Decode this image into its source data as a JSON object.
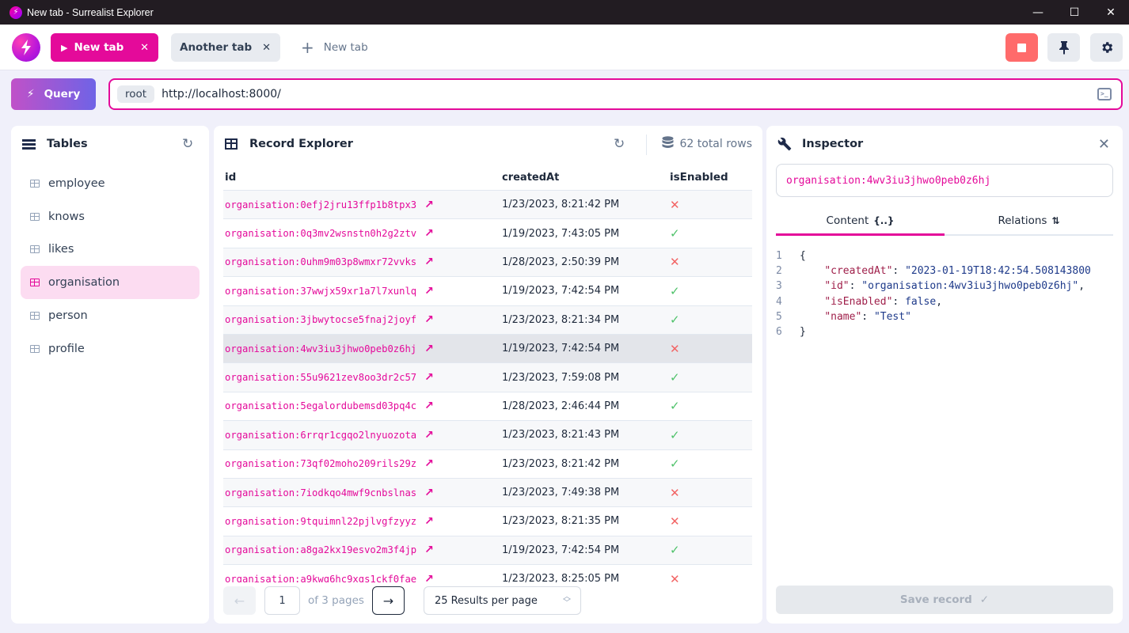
{
  "window": {
    "title": "New tab - Surrealist Explorer",
    "controls": {
      "minimize": "—",
      "maximize": "☐",
      "close": "✕"
    }
  },
  "tabs": [
    {
      "label": "New tab",
      "active": true,
      "close": "✕"
    },
    {
      "label": "Another tab",
      "active": false,
      "close": "✕"
    }
  ],
  "new_tab": {
    "label": "New tab",
    "icon": "+"
  },
  "toolbar": {
    "stop_label": "",
    "pin_icon": "📌",
    "settings_icon": "⚙"
  },
  "query_button": {
    "label": "Query",
    "icon": "⚡"
  },
  "connection": {
    "user": "root",
    "url": "http://localhost:8000/",
    "console_icon": ">_"
  },
  "tables_panel": {
    "title": "Tables",
    "items": [
      {
        "label": "employee",
        "active": false
      },
      {
        "label": "knows",
        "active": false
      },
      {
        "label": "likes",
        "active": false
      },
      {
        "label": "organisation",
        "active": true
      },
      {
        "label": "person",
        "active": false
      },
      {
        "label": "profile",
        "active": false
      }
    ]
  },
  "records_panel": {
    "title": "Record Explorer",
    "total_rows": "62 total rows",
    "columns": [
      "id",
      "createdAt",
      "isEnabled"
    ],
    "rows": [
      {
        "id": "organisation:0efj2jru13ffp1b8tpx3",
        "createdAt": "1/23/2023, 8:21:42 PM",
        "isEnabled": false
      },
      {
        "id": "organisation:0q3mv2wsnstn0h2g2ztv",
        "createdAt": "1/19/2023, 7:43:05 PM",
        "isEnabled": true
      },
      {
        "id": "organisation:0uhm9m03p8wmxr72vvks",
        "createdAt": "1/28/2023, 2:50:39 PM",
        "isEnabled": false
      },
      {
        "id": "organisation:37wwjx59xr1a7l7xunlq",
        "createdAt": "1/19/2023, 7:42:54 PM",
        "isEnabled": true
      },
      {
        "id": "organisation:3jbwytocse5fnaj2joyf",
        "createdAt": "1/23/2023, 8:21:34 PM",
        "isEnabled": true
      },
      {
        "id": "organisation:4wv3iu3jhwo0peb0z6hj",
        "createdAt": "1/19/2023, 7:42:54 PM",
        "isEnabled": false,
        "selected": true
      },
      {
        "id": "organisation:55u9621zev8oo3dr2c57",
        "createdAt": "1/23/2023, 7:59:08 PM",
        "isEnabled": true
      },
      {
        "id": "organisation:5egalordubemsd03pq4c",
        "createdAt": "1/28/2023, 2:46:44 PM",
        "isEnabled": true
      },
      {
        "id": "organisation:6rrqr1cgqo2lnyuozota",
        "createdAt": "1/23/2023, 8:21:43 PM",
        "isEnabled": true
      },
      {
        "id": "organisation:73qf02moho209rils29z",
        "createdAt": "1/23/2023, 8:21:42 PM",
        "isEnabled": true
      },
      {
        "id": "organisation:7iodkqo4mwf9cnbslnas",
        "createdAt": "1/23/2023, 7:49:38 PM",
        "isEnabled": false
      },
      {
        "id": "organisation:9tquimnl22pjlvgfzyyz",
        "createdAt": "1/23/2023, 8:21:35 PM",
        "isEnabled": false
      },
      {
        "id": "organisation:a8ga2kx19esvo2m3f4jp",
        "createdAt": "1/19/2023, 7:42:54 PM",
        "isEnabled": true
      },
      {
        "id": "organisation:a9kwg6hc9xgs1ckf0fae",
        "createdAt": "1/23/2023, 8:25:05 PM",
        "isEnabled": false
      }
    ],
    "pagination": {
      "current_page": "1",
      "of_label": "of 3 pages",
      "prev_icon": "←",
      "next_icon": "→",
      "per_page": "25 Results per page"
    }
  },
  "inspector": {
    "title": "Inspector",
    "record_id": "organisation:4wv3iu3jhwo0peb0z6hj",
    "tabs": [
      {
        "label": "Content",
        "icon": "{..}",
        "active": true
      },
      {
        "label": "Relations",
        "icon": "⇅",
        "active": false
      }
    ],
    "code_lines": [
      {
        "n": "1",
        "parts": [
          [
            "p",
            "{"
          ]
        ]
      },
      {
        "n": "2",
        "parts": [
          [
            "p",
            "    "
          ],
          [
            "k",
            "\"createdAt\""
          ],
          [
            "p",
            ": "
          ],
          [
            "s",
            "\"2023-01-19T18:42:54.508143800"
          ]
        ]
      },
      {
        "n": "3",
        "parts": [
          [
            "p",
            "    "
          ],
          [
            "k",
            "\"id\""
          ],
          [
            "p",
            ": "
          ],
          [
            "s",
            "\"organisation:4wv3iu3jhwo0peb0z6hj\""
          ],
          [
            "p",
            ","
          ]
        ]
      },
      {
        "n": "4",
        "parts": [
          [
            "p",
            "    "
          ],
          [
            "k",
            "\"isEnabled\""
          ],
          [
            "p",
            ": "
          ],
          [
            "b",
            "false"
          ],
          [
            "p",
            ","
          ]
        ]
      },
      {
        "n": "5",
        "parts": [
          [
            "p",
            "    "
          ],
          [
            "k",
            "\"name\""
          ],
          [
            "p",
            ": "
          ],
          [
            "s",
            "\"Test\""
          ]
        ]
      },
      {
        "n": "6",
        "parts": [
          [
            "p",
            "}"
          ]
        ]
      }
    ],
    "save_label": "Save record",
    "save_icon": "✓"
  },
  "colors": {
    "accent": "#e40a9a",
    "stop": "#ff6b6b",
    "enabled": "#4fc26a",
    "disabled": "#f26464"
  }
}
